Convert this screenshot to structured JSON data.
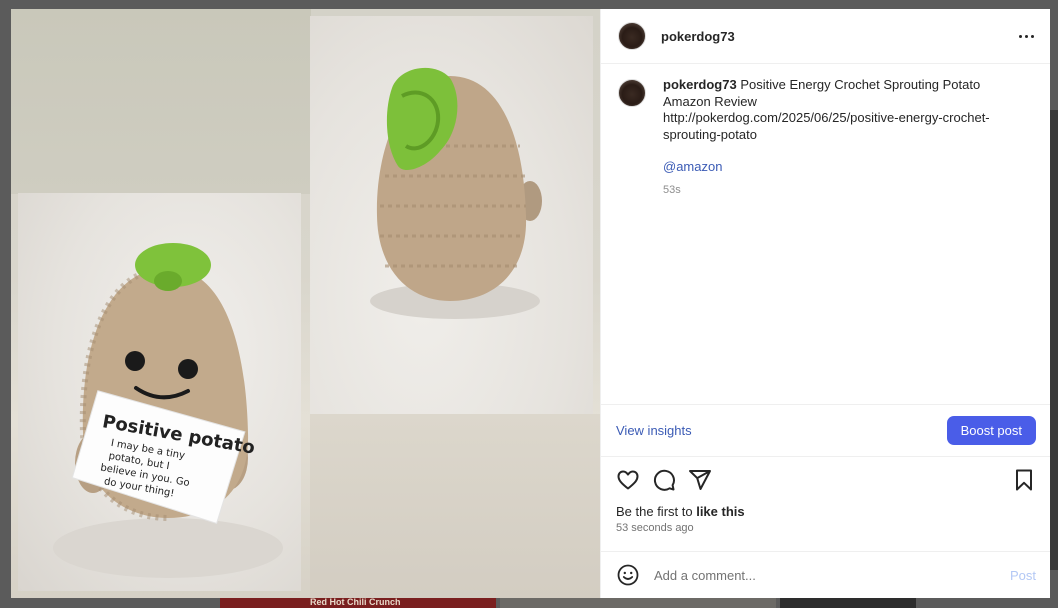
{
  "background": {
    "bottom_card_text": "Red Hot Chili Crunch"
  },
  "post": {
    "username": "pokerdog73",
    "caption": {
      "author": "pokerdog73",
      "line1": "Positive Energy Crochet Sprouting Potato",
      "line2": "Amazon Review",
      "line3": "http://pokerdog.com/2025/06/25/positive-energy-crochet-",
      "line4": "sprouting-potato",
      "mention": "@amazon",
      "age": "53s"
    },
    "media": {
      "photo_left_sign_title": "Positive potato",
      "photo_left_sign_body": [
        "I may be a tiny",
        "potato, but I",
        "believe in you. Go",
        "do your thing!"
      ]
    },
    "insights_label": "View insights",
    "boost_label": "Boost post",
    "likes_prefix": "Be the first to ",
    "likes_action": "like this",
    "posted_ago": "53 seconds ago",
    "comment_placeholder": "Add a comment...",
    "post_button": "Post"
  },
  "icons": [
    "more-icon",
    "heart-icon",
    "comment-icon",
    "share-icon",
    "bookmark-icon",
    "emoji-icon"
  ],
  "colors": {
    "accent": "#4a5de8",
    "link": "#3b5bb5",
    "post_disabled": "#b3c8f5"
  }
}
